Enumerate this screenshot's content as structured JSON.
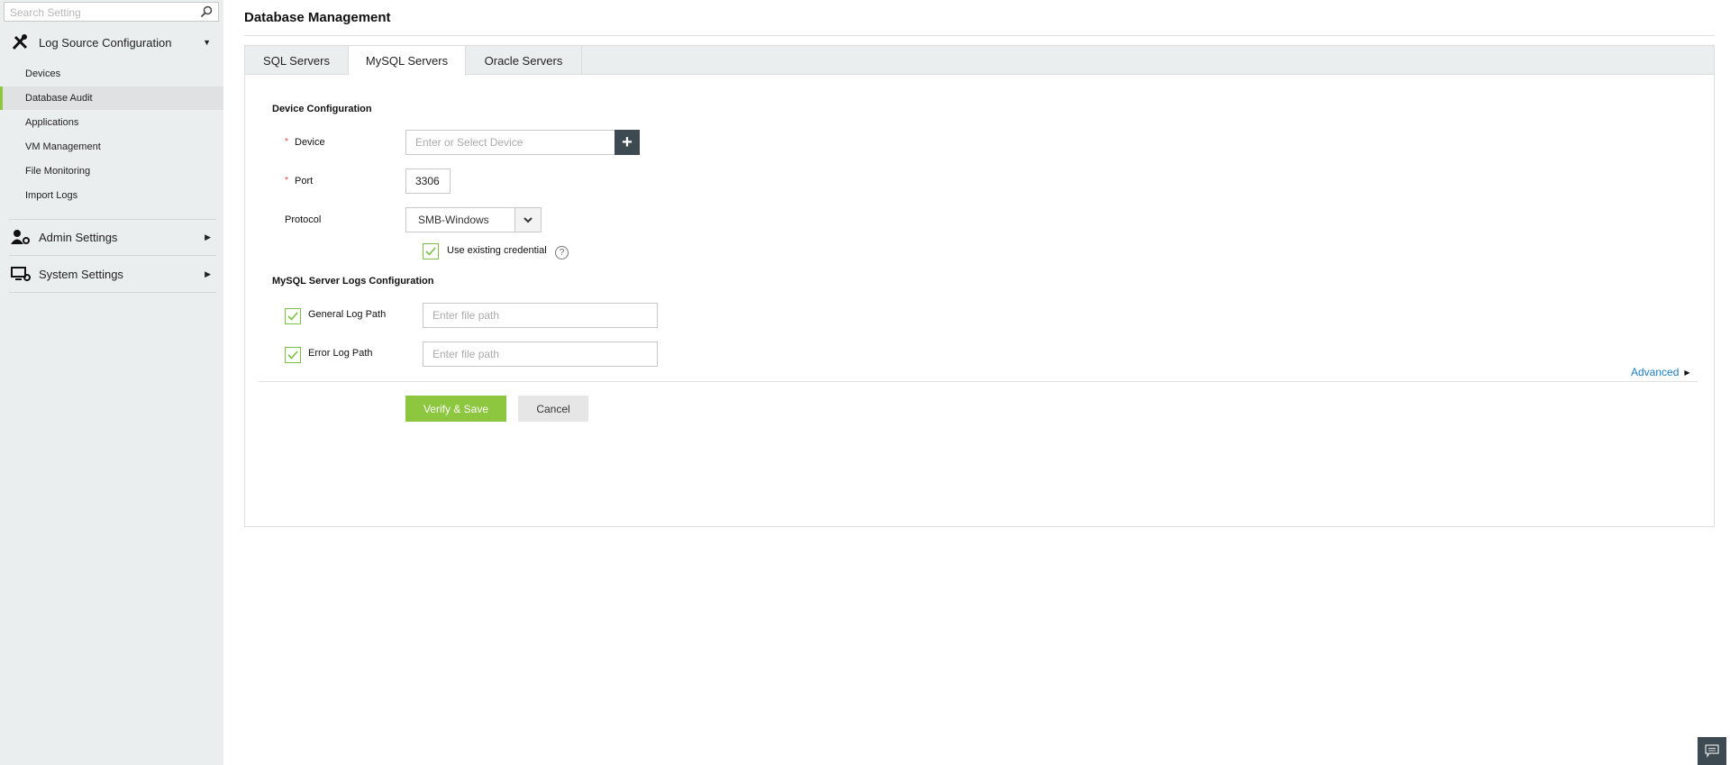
{
  "sidebar": {
    "search_placeholder": "Search Setting",
    "groups": [
      {
        "label": "Log Source Configuration",
        "icon": "tools-icon",
        "expanded": true,
        "items": [
          {
            "label": "Devices"
          },
          {
            "label": "Database Audit",
            "active": true
          },
          {
            "label": "Applications"
          },
          {
            "label": "VM Management"
          },
          {
            "label": "File Monitoring"
          },
          {
            "label": "Import Logs"
          }
        ]
      },
      {
        "label": "Admin Settings",
        "icon": "admin-settings-icon",
        "expanded": false
      },
      {
        "label": "System Settings",
        "icon": "system-settings-icon",
        "expanded": false
      }
    ]
  },
  "page": {
    "title": "Database Management"
  },
  "tabs": [
    {
      "label": "SQL Servers"
    },
    {
      "label": "MySQL Servers",
      "active": true
    },
    {
      "label": "Oracle Servers"
    }
  ],
  "form": {
    "device_config_heading": "Device Configuration",
    "device_label": "Device",
    "device_placeholder": "Enter or Select Device",
    "port_label": "Port",
    "port_value": "3306",
    "protocol_label": "Protocol",
    "protocol_value": "SMB-Windows",
    "use_existing_credential": "Use existing credential",
    "use_existing_checked": true,
    "logs_heading": "MySQL Server Logs Configuration",
    "general_log_label": "General Log Path",
    "general_log_placeholder": "Enter file path",
    "general_checked": true,
    "error_log_label": "Error Log Path",
    "error_log_placeholder": "Enter file path",
    "error_checked": true,
    "required_mark": "*",
    "advanced_label": "Advanced",
    "verify_save": "Verify & Save",
    "cancel": "Cancel"
  },
  "colors": {
    "accent": "#8dc63f",
    "link": "#1a7fc1",
    "dark_button": "#3d4a52"
  }
}
